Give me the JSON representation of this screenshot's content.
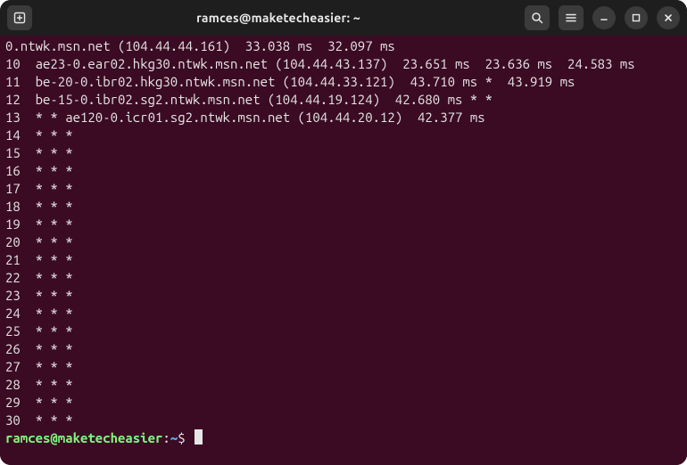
{
  "titlebar": {
    "title": "ramces@maketecheasier: ~"
  },
  "terminal": {
    "lines": [
      "0.ntwk.msn.net (104.44.44.161)  33.038 ms  32.097 ms",
      "10  ae23-0.ear02.hkg30.ntwk.msn.net (104.44.43.137)  23.651 ms  23.636 ms  24.583 ms",
      "11  be-20-0.ibr02.hkg30.ntwk.msn.net (104.44.33.121)  43.710 ms *  43.919 ms",
      "12  be-15-0.ibr02.sg2.ntwk.msn.net (104.44.19.124)  42.680 ms * *",
      "13  * * ae120-0.icr01.sg2.ntwk.msn.net (104.44.20.12)  42.377 ms",
      "14  * * *",
      "15  * * *",
      "16  * * *",
      "17  * * *",
      "18  * * *",
      "19  * * *",
      "20  * * *",
      "21  * * *",
      "22  * * *",
      "23  * * *",
      "24  * * *",
      "25  * * *",
      "26  * * *",
      "27  * * *",
      "28  * * *",
      "29  * * *",
      "30  * * *"
    ],
    "prompt": {
      "user_host": "ramces@maketecheasier",
      "colon": ":",
      "path": "~",
      "dollar": "$"
    }
  }
}
